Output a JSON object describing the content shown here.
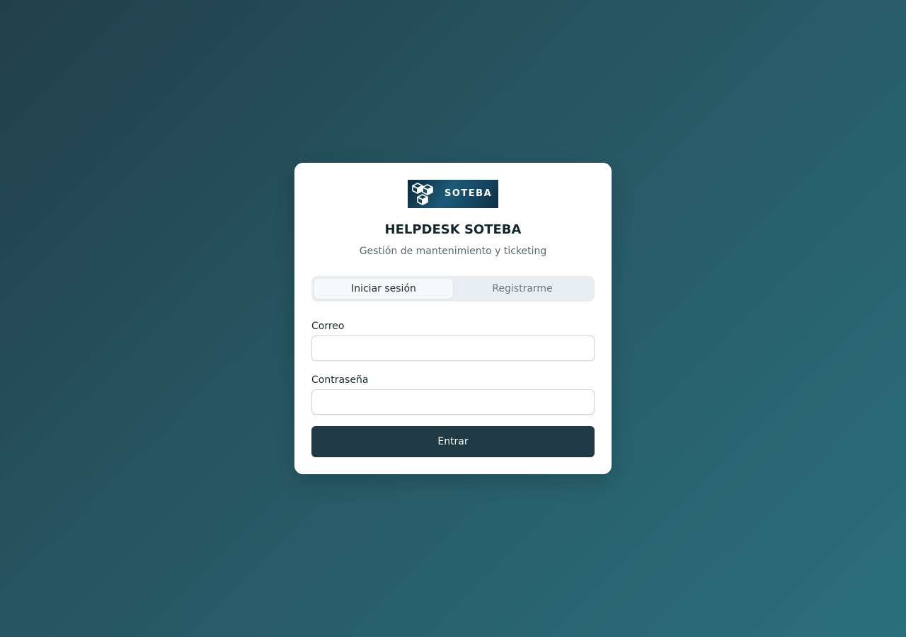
{
  "brand": {
    "logo_text": "SOTEBA",
    "title": "HELPDESK SOTEBA",
    "subtitle": "Gestión de mantenimiento y ticketing"
  },
  "tabs": [
    {
      "label": "Iniciar sesión",
      "active": true
    },
    {
      "label": "Registrarme",
      "active": false
    }
  ],
  "form": {
    "email_label": "Correo",
    "email_value": "",
    "password_label": "Contraseña",
    "password_value": "",
    "submit_label": "Entrar"
  },
  "colors": {
    "background_start": "#213f4a",
    "background_end": "#2a6f7c",
    "button": "#1f3a44"
  }
}
